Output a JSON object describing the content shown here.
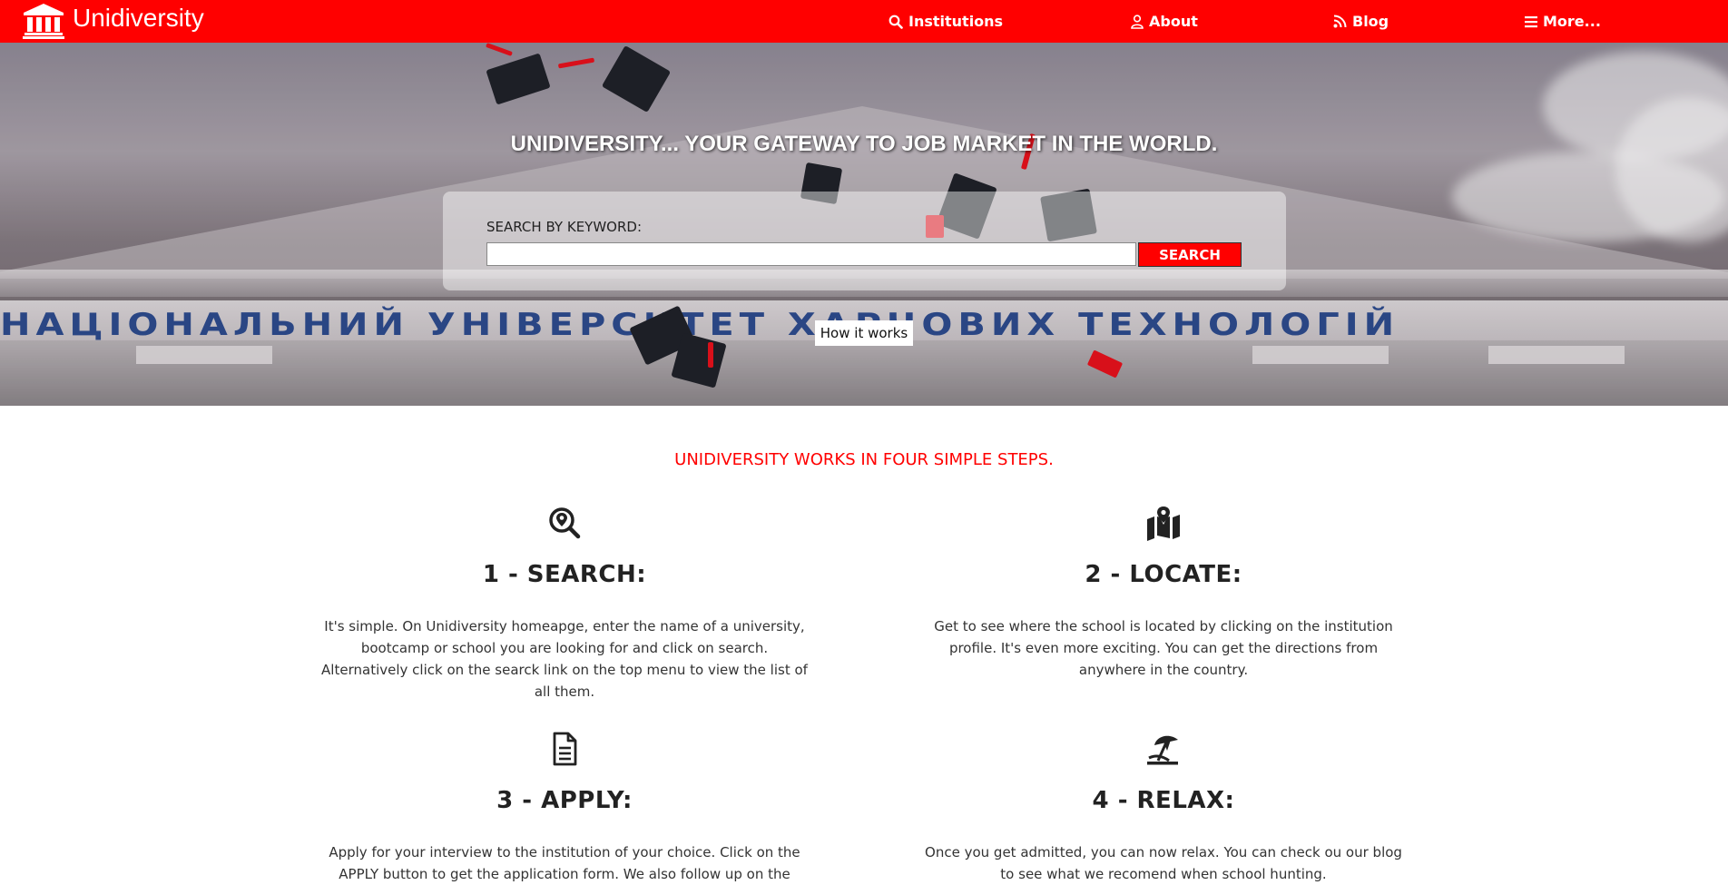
{
  "nav": {
    "brand": "Unidiversity",
    "items": [
      {
        "label": "Institutions",
        "icon": "search-icon"
      },
      {
        "label": "About",
        "icon": "user-icon"
      },
      {
        "label": "Blog",
        "icon": "rss-icon"
      },
      {
        "label": "More...",
        "icon": "menu-icon"
      }
    ]
  },
  "hero": {
    "title": "UNIDIVERSITY... YOUR GATEWAY TO JOB MARKET IN THE WORLD.",
    "search_label": "SEARCH BY KEYWORD:",
    "search_value": "",
    "search_button": "SEARCH",
    "how_button": "How it works"
  },
  "steps": {
    "heading": "UNIDIVERSITY WORKS IN FOUR SIMPLE STEPS.",
    "items": [
      {
        "icon": "search-location-icon",
        "title": "1 - SEARCH:",
        "text": "It's simple. On Unidiversity homeapge, enter the name of a university, bootcamp or school you are looking for and click on search. Alternatively click on the searck link on the top menu to view the list of all them."
      },
      {
        "icon": "map-marked-icon",
        "title": "2 - LOCATE:",
        "text": "Get to see where the school is located by clicking on the institution profile. It's even more exciting. You can get the directions from anywhere in the country."
      },
      {
        "icon": "document-icon",
        "title": "3 - APPLY:",
        "text": "Apply for your interview to the institution of your choice. Click on the APPLY button to get the application form. We also follow up on the"
      },
      {
        "icon": "umbrella-beach-icon",
        "title": "4 - RELAX:",
        "text": "Once you get admitted, you can now relax. You can check ou our blog to see what we recomend when school hunting."
      }
    ]
  },
  "colors": {
    "brand": "#ff0000",
    "text": "#222222"
  }
}
